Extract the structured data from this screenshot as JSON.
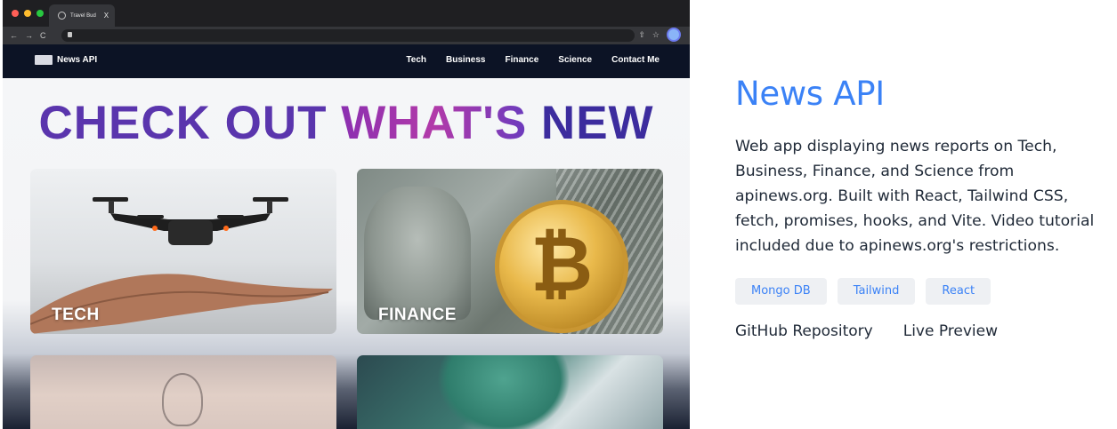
{
  "browser": {
    "tab_title": "Travel Bud",
    "tab_close": "X",
    "nav": {
      "back": "←",
      "forward": "→",
      "reload": "C"
    },
    "toolbar_icons": {
      "share": "⇧",
      "star": "☆"
    }
  },
  "site": {
    "logo_text": "News API",
    "nav_links": [
      "Tech",
      "Business",
      "Finance",
      "Science",
      "Contact Me"
    ],
    "hero": {
      "part1": "CHECK OUT ",
      "part2": "WHAT'S",
      "part3": " NEW"
    },
    "cards": [
      {
        "label": "TECH"
      },
      {
        "label": "FINANCE"
      },
      {
        "label": ""
      },
      {
        "label": ""
      }
    ]
  },
  "project": {
    "title": "News API",
    "description": "Web app displaying news reports on Tech, Business, Finance, and Science from apinews.org. Built with React, Tailwind CSS, fetch, promises, hooks, and Vite. Video tutorial included due to apinews.org's restrictions.",
    "tags": [
      "Mongo DB",
      "Tailwind",
      "React"
    ],
    "links": {
      "repo": "GitHub Repository",
      "preview": "Live Preview"
    }
  },
  "colors": {
    "accent": "#3b82f6",
    "nav_bg": "#0c1325",
    "tag_bg": "#eef0f3",
    "dot_red": "#ff5f57",
    "dot_yellow": "#febc2e",
    "dot_green": "#28c840"
  }
}
